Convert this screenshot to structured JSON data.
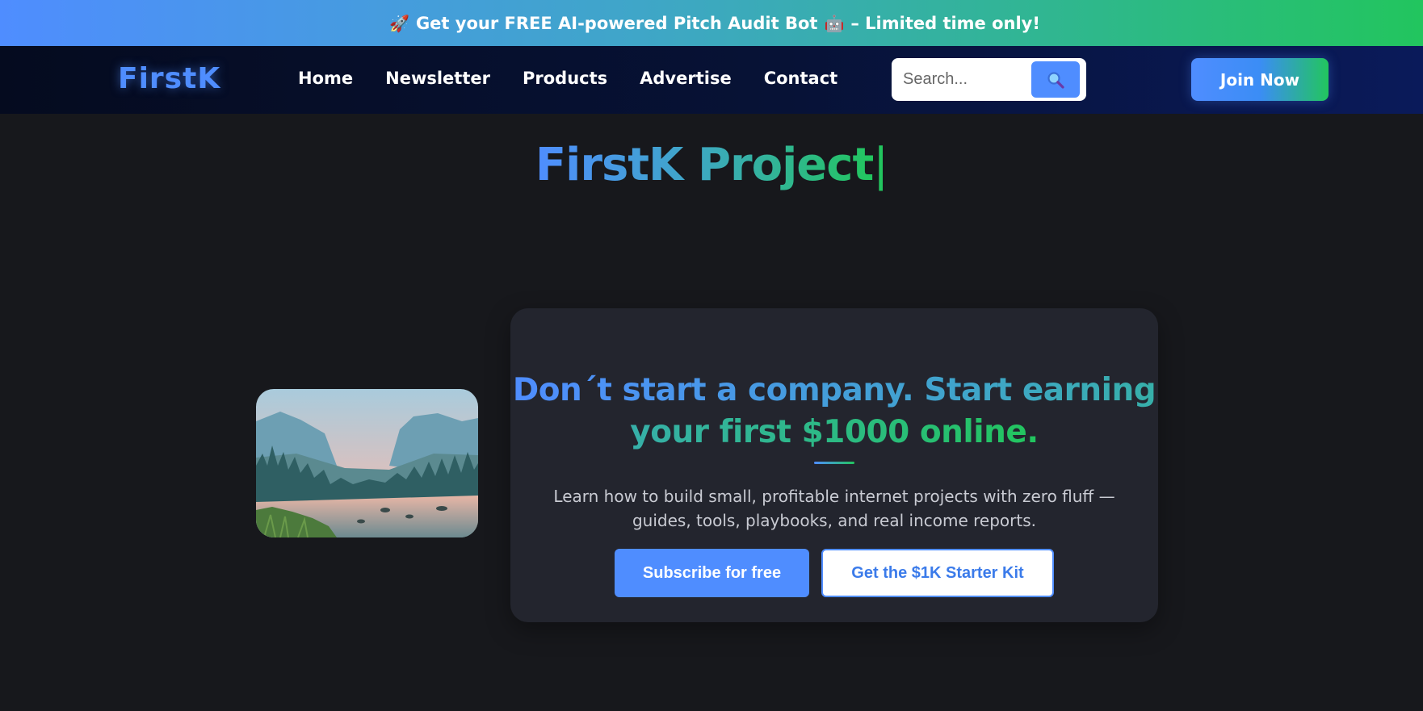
{
  "promo": {
    "rocket_icon": "rocket-icon",
    "text": "Get your FREE AI-powered Pitch Audit Bot",
    "robot_icon": "robot-icon",
    "suffix": "– Limited time only!"
  },
  "nav": {
    "logo": "FirstK",
    "links": [
      "Home",
      "Newsletter",
      "Products",
      "Advertise",
      "Contact"
    ],
    "search_placeholder": "Search...",
    "search_icon": "search-icon",
    "join_label": "Join Now"
  },
  "hero": {
    "title": "FirstK Project",
    "cursor": "|"
  },
  "card": {
    "heading": "Don´t start a company. Start earning your first $1000 online.",
    "description": "Learn how to build small, profitable internet projects with zero fluff — guides, tools, playbooks, and real income reports.",
    "primary_cta": "Subscribe for free",
    "secondary_cta": "Get the $1K Starter Kit"
  },
  "colors": {
    "accent_blue": "#4f8dff",
    "accent_green": "#22c55e",
    "background": "#17181c",
    "card": "#23252e"
  }
}
